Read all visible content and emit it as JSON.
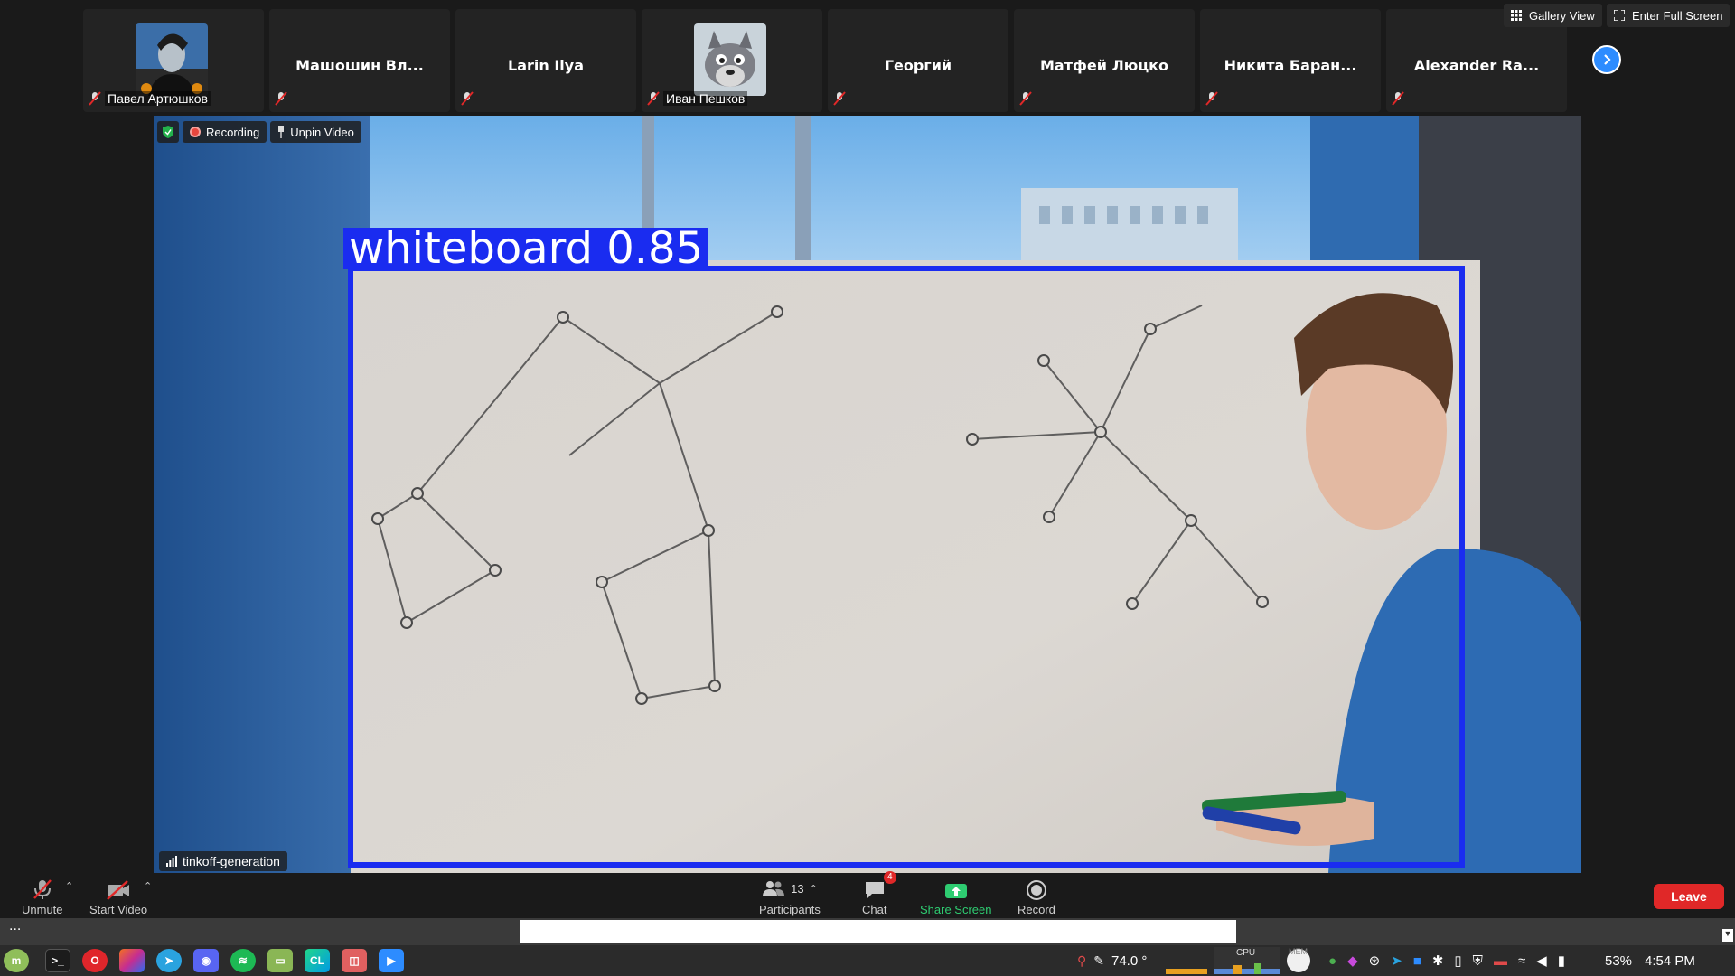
{
  "top_controls": {
    "gallery_view": "Gallery View",
    "full_screen": "Enter Full Screen"
  },
  "participants": [
    {
      "display": "",
      "name": "Павел Артюшков",
      "avatar": "person-avatar"
    },
    {
      "display": "Машошин Вл...",
      "name": ""
    },
    {
      "display": "Larin Ilya",
      "name": ""
    },
    {
      "display": "",
      "name": "Иван Пешков",
      "avatar": "wolf-avatar"
    },
    {
      "display": "Георгий",
      "name": ""
    },
    {
      "display": "Матфей Люцко",
      "name": ""
    },
    {
      "display": "Никита Баран...",
      "name": ""
    },
    {
      "display": "Alexander Ra...",
      "name": ""
    }
  ],
  "video": {
    "recording_label": "Recording",
    "unpin_label": "Unpin Video",
    "speaker_name": "tinkoff-generation",
    "detection_label": "whiteboard 0.85",
    "detection_color": "#1a2cf0"
  },
  "controls": {
    "unmute": "Unmute",
    "start_video": "Start Video",
    "participants": "Participants",
    "participants_count": "13",
    "chat": "Chat",
    "chat_badge": "4",
    "share_screen": "Share Screen",
    "record": "Record",
    "leave": "Leave",
    "more": "..."
  },
  "taskbar": {
    "temperature": "74.0 °",
    "cpu_label": "CPU",
    "mem_label": "MEM",
    "battery": "53%",
    "time": "4:54 PM",
    "apps": [
      "mint-menu",
      "terminal",
      "opera",
      "jetbrains-toolbox",
      "telegram",
      "discord",
      "spotify",
      "files",
      "clion",
      "app-icon",
      "zoom"
    ]
  },
  "colors": {
    "accent": "#2d8cff",
    "leave": "#e02828",
    "share": "#2ecc71",
    "recording": "#e8473f"
  }
}
